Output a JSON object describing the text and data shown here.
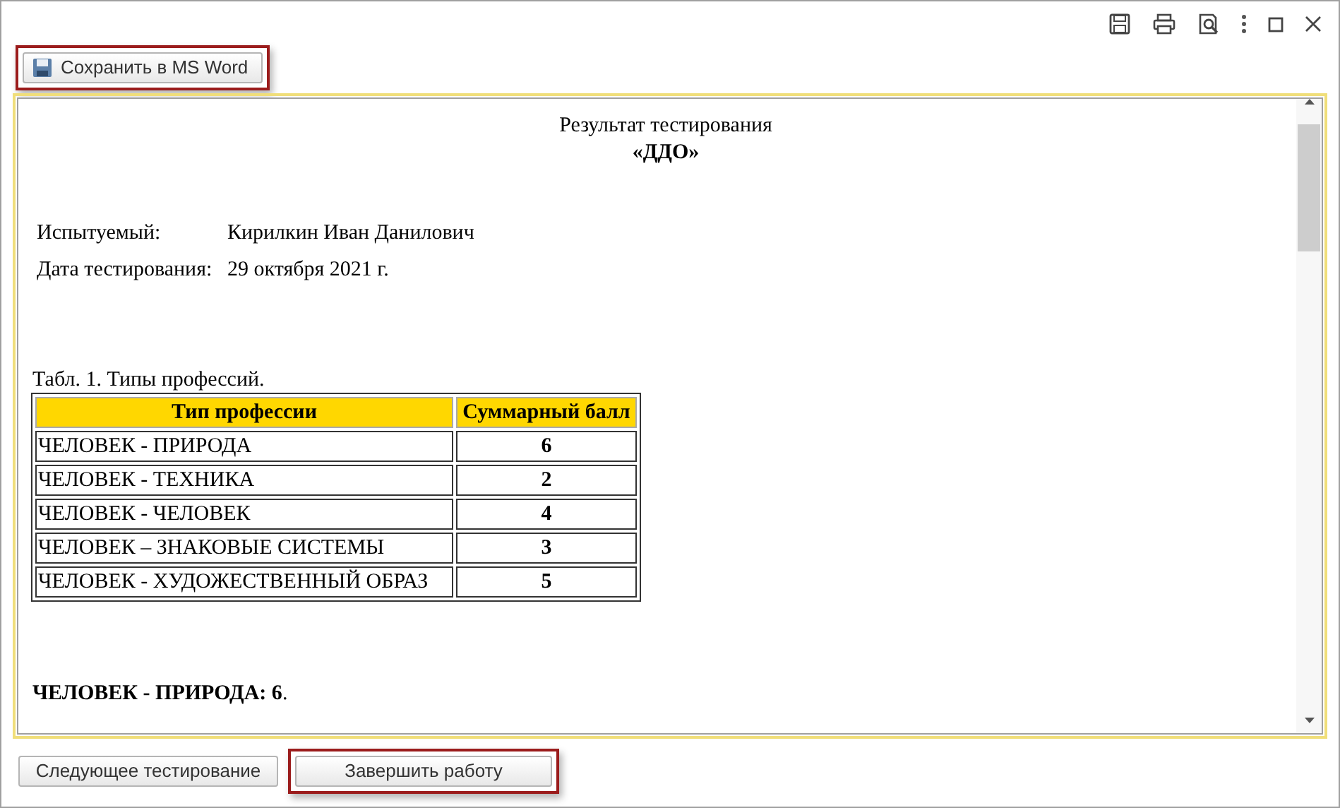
{
  "toolbar": {
    "save_button": {
      "label": "Сохранить в MS Word",
      "highlighted": true
    }
  },
  "report": {
    "title": "Результат тестирования",
    "subtitle": "«ДДО»",
    "fields": [
      {
        "label": "Испытуемый:",
        "value": "Кирилкин Иван Данилович"
      },
      {
        "label": "Дата тестирования:",
        "value": "29 октября 2021 г."
      }
    ],
    "table_caption": "Табл. 1. Типы профессий.",
    "table": {
      "columns": [
        "Тип профессии",
        "Суммарный балл"
      ],
      "rows": [
        [
          "ЧЕЛОВЕК - ПРИРОДА",
          "6"
        ],
        [
          "ЧЕЛОВЕК - ТЕХНИКА",
          "2"
        ],
        [
          "ЧЕЛОВЕК - ЧЕЛОВЕК",
          "4"
        ],
        [
          "ЧЕЛОВЕК – ЗНАКОВЫЕ СИСТЕМЫ",
          "3"
        ],
        [
          "ЧЕЛОВЕК - ХУДОЖЕСТВЕННЫЙ ОБРАЗ",
          "5"
        ]
      ]
    },
    "conclusion": "**ЧЕЛОВЕК - ПРИРОДА: 6**."
  },
  "footer_buttons": [
    {
      "label": "Следующее тестирование",
      "highlighted": false
    },
    {
      "label": "Завершить работу",
      "highlighted": true
    }
  ]
}
